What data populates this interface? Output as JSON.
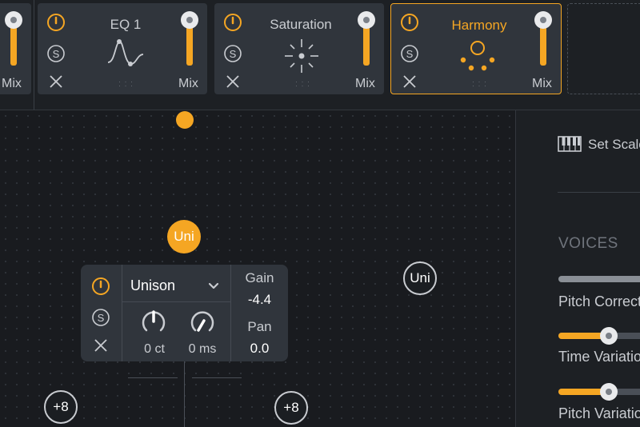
{
  "cards": [
    {
      "id": "partial",
      "mix_label": "Mix"
    },
    {
      "id": "eq1",
      "title": "EQ 1",
      "mix_label": "Mix"
    },
    {
      "id": "saturation",
      "title": "Saturation",
      "mix_label": "Mix"
    },
    {
      "id": "harmony",
      "title": "Harmony",
      "mix_label": "Mix",
      "selected": true
    }
  ],
  "canvas": {
    "nodes": {
      "uni_active": "Uni",
      "uni_inactive": "Uni",
      "plus_left": "+8",
      "plus_right": "+8"
    }
  },
  "unison_panel": {
    "mode_value": "Unison",
    "knob1_value": "0 ct",
    "knob2_value": "0 ms",
    "gain_label": "Gain",
    "gain_value": "-4.4",
    "pan_label": "Pan",
    "pan_value": "0.0"
  },
  "right_panel": {
    "set_scale_label": "Set Scale",
    "voices_heading": "VOICES",
    "pitch_correction_label": "Pitch Correction",
    "time_variation_label": "Time Variation",
    "pitch_variation_label": "Pitch Variation"
  },
  "colors": {
    "accent": "#f5a623",
    "card_bg": "#30353c",
    "background": "#191b1f"
  }
}
